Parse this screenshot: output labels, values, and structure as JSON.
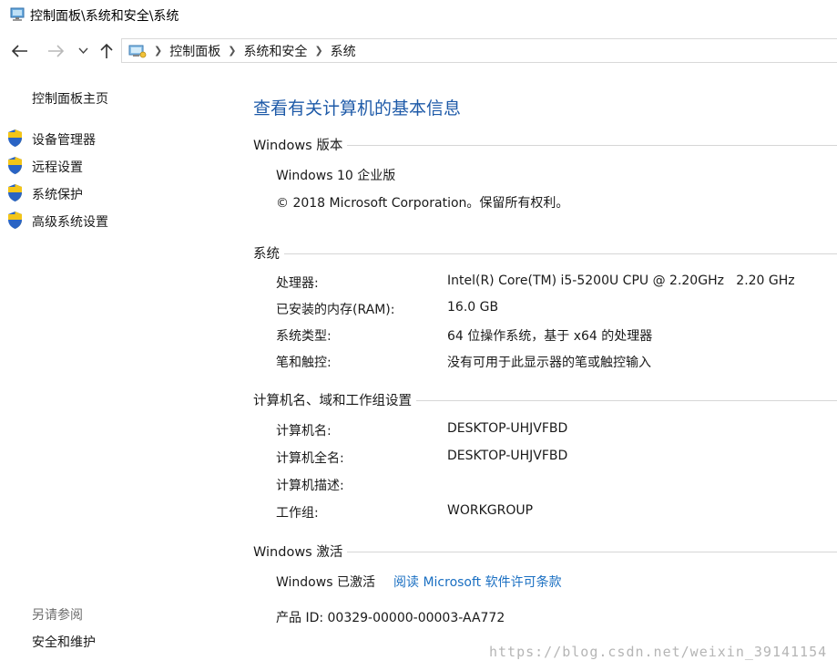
{
  "window": {
    "title": "控制面板\\系统和安全\\系统"
  },
  "nav": {
    "back_icon": "arrow-left-icon",
    "forward_icon": "arrow-right-icon",
    "recent_icon": "chevron-down-icon",
    "up_icon": "arrow-up-icon"
  },
  "breadcrumb": [
    "控制面板",
    "系统和安全",
    "系统"
  ],
  "sidebar": {
    "home": "控制面板主页",
    "links": [
      "设备管理器",
      "远程设置",
      "系统保护",
      "高级系统设置"
    ],
    "see_also_title": "另请参阅",
    "see_also_links": [
      "安全和维护"
    ]
  },
  "main": {
    "title": "查看有关计算机的基本信息",
    "edition": {
      "heading": "Windows 版本",
      "name": "Windows 10 企业版",
      "copyright": "© 2018 Microsoft Corporation。保留所有权利。"
    },
    "system": {
      "heading": "系统",
      "rows": [
        {
          "label": "处理器:",
          "value": "Intel(R) Core(TM) i5-5200U CPU @ 2.20GHz   2.20 GHz"
        },
        {
          "label": "已安装的内存(RAM):",
          "value": "16.0 GB"
        },
        {
          "label": "系统类型:",
          "value": "64 位操作系统，基于 x64 的处理器"
        },
        {
          "label": "笔和触控:",
          "value": "没有可用于此显示器的笔或触控输入"
        }
      ]
    },
    "computer": {
      "heading": "计算机名、域和工作组设置",
      "rows": [
        {
          "label": "计算机名:",
          "value": "DESKTOP-UHJVFBD"
        },
        {
          "label": "计算机全名:",
          "value": "DESKTOP-UHJVFBD"
        },
        {
          "label": "计算机描述:",
          "value": ""
        },
        {
          "label": "工作组:",
          "value": "WORKGROUP"
        }
      ]
    },
    "activation": {
      "heading": "Windows 激活",
      "status": "Windows 已激活",
      "license_link": "阅读 Microsoft 软件许可条款",
      "product_id": "产品 ID: 00329-00000-00003-AA772"
    }
  },
  "watermark": "https://blog.csdn.net/weixin_39141154",
  "colors": {
    "accent": "#1e5aa8",
    "link": "#1a6fc2",
    "rule": "#d6d6d6"
  }
}
